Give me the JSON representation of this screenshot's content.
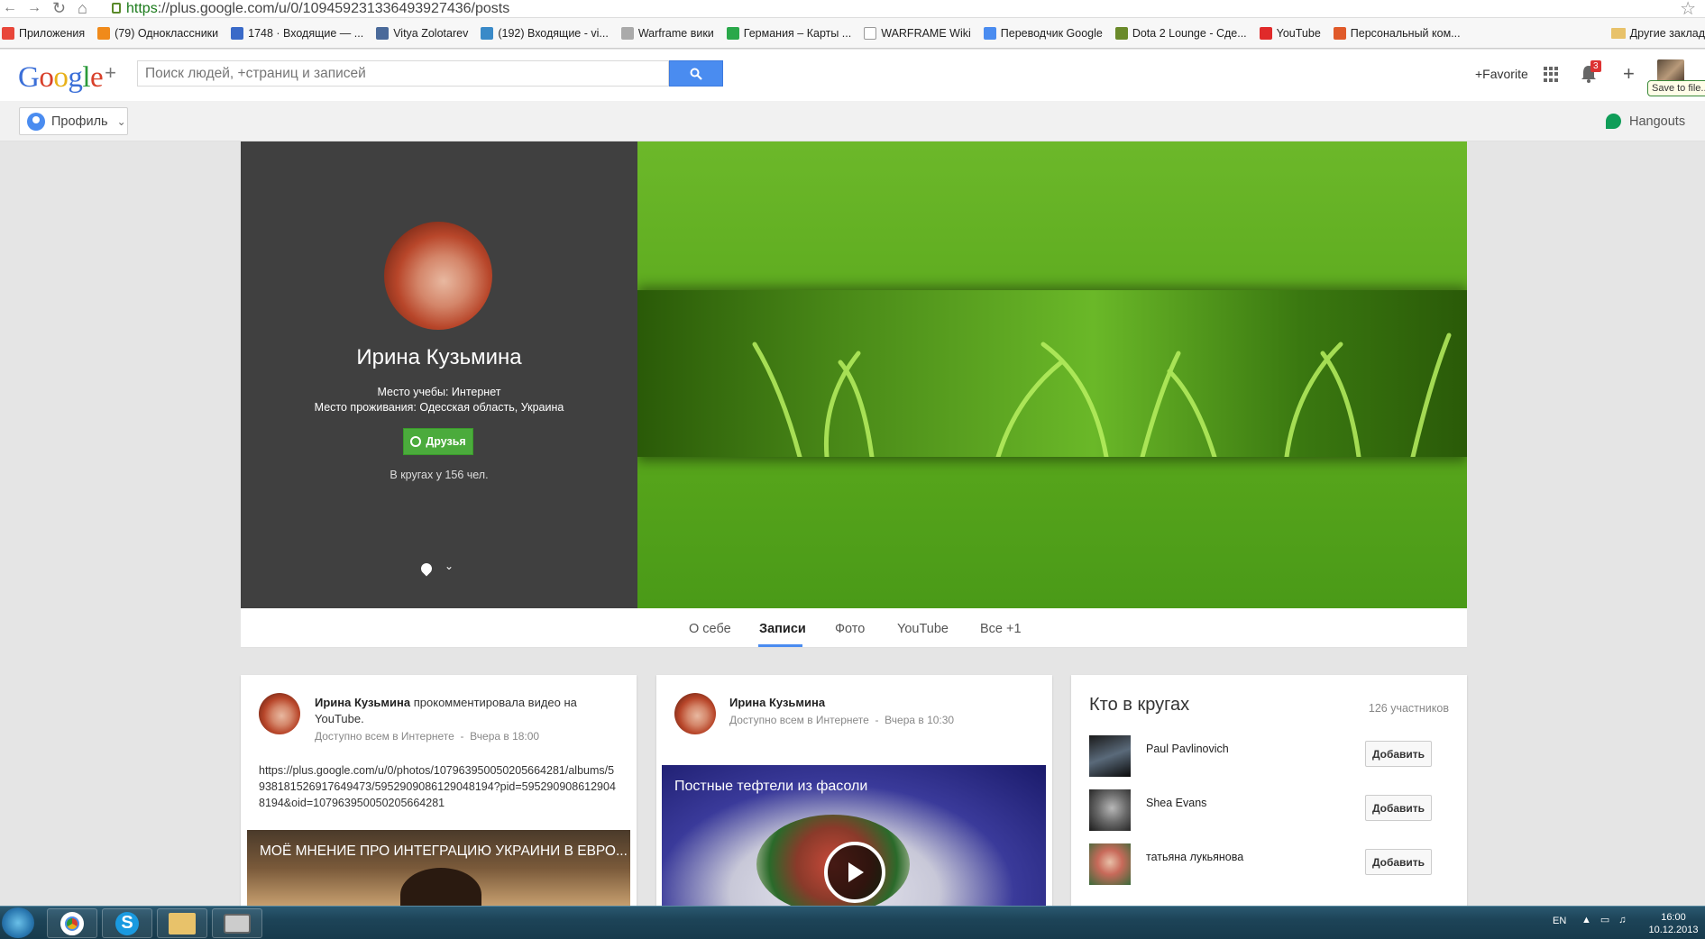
{
  "browser": {
    "url_https": "https",
    "url_rest": "://plus.google.com/u/0/109459231336493927436/posts",
    "bookmarks": [
      {
        "label": "Приложения",
        "color": "#e8463a"
      },
      {
        "label": "(79) Одноклассники",
        "color": "#f08a1a"
      },
      {
        "label": "1748 · Входящие — ...",
        "color": "#3a6ac8"
      },
      {
        "label": "Vitya Zolotarev",
        "color": "#4a6a9a"
      },
      {
        "label": "(192) Входящие - vi...",
        "color": "#3a8ac8"
      },
      {
        "label": "Warframe вики",
        "color": "#aaaaaa"
      },
      {
        "label": "Германия – Карты ...",
        "color": "#2aa84a"
      },
      {
        "label": "WARFRAME Wiki",
        "color": "#ffffff"
      },
      {
        "label": "Переводчик Google",
        "color": "#4a8cf0"
      },
      {
        "label": "Dota 2 Lounge - Сде...",
        "color": "#6a8a2a"
      },
      {
        "label": "YouTube",
        "color": "#e02a2a"
      },
      {
        "label": "Персональный ком...",
        "color": "#e05a2a"
      }
    ],
    "other_bookmarks": "Другие заклад"
  },
  "header": {
    "logo_letters": [
      {
        "ch": "G",
        "color": "#3b6fd8"
      },
      {
        "ch": "o",
        "color": "#d8402a"
      },
      {
        "ch": "o",
        "color": "#e8b018"
      },
      {
        "ch": "g",
        "color": "#3b6fd8"
      },
      {
        "ch": "l",
        "color": "#2a9a3a"
      },
      {
        "ch": "e",
        "color": "#d8402a"
      }
    ],
    "logo_plus": "+",
    "search_placeholder": "Поиск людей, +страниц и записей",
    "favorite": "+Favorite",
    "notification_count": "3",
    "tooltip": "Save to file..."
  },
  "subbar": {
    "profile_menu": "Профиль",
    "hangouts": "Hangouts"
  },
  "profile": {
    "name": "Ирина Кузьмина",
    "education": "Место учебы: Интернет",
    "residence": "Место проживания: Одесская область, Украина",
    "friends_button": "Друзья",
    "circles_text": "В кругах у 156 чел."
  },
  "tabs": [
    {
      "label": "О себе",
      "active": false
    },
    {
      "label": "Записи",
      "active": true
    },
    {
      "label": "Фото",
      "active": false
    },
    {
      "label": "YouTube",
      "active": false
    },
    {
      "label": "Все +1",
      "active": false
    }
  ],
  "posts": [
    {
      "author": "Ирина Кузьмина",
      "action": "прокомментировала видео на YouTube.",
      "visibility": "Доступно всем в Интернете",
      "time": "Вчера в 18:00",
      "text": "https://plus.google.com/u/0/photos/107963950050205664281/albums/5938181526917649473/5952909086129048194?pid=5952909086129048194&oid=107963950050205664281",
      "video_title": "МОЁ МНЕНИЕ ПРО ИНТЕГРАЦИЮ УКРАИНИ В ЕВРО..."
    },
    {
      "author": "Ирина Кузьмина",
      "visibility": "Доступно всем в Интернете",
      "time": "Вчера в 10:30",
      "video_title": "Постные тефтели из фасоли"
    }
  ],
  "circles_widget": {
    "title": "Кто в кругах",
    "count": "126 участников",
    "add_label": "Добавить",
    "people": [
      {
        "name": "Paul Pavlinovich"
      },
      {
        "name": "Shea Evans"
      },
      {
        "name": "татьяна лукьянова"
      }
    ]
  },
  "taskbar": {
    "lang": "EN",
    "time": "16:00",
    "date": "10.12.2013"
  },
  "colors": {
    "google_blue": "#4a8cf0",
    "friends_green": "#4bab3c",
    "badge_red": "#dd3333"
  }
}
